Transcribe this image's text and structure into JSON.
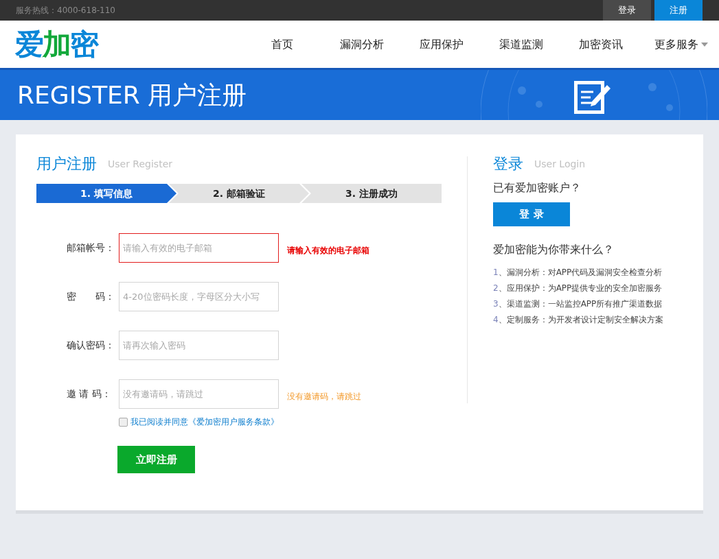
{
  "top_bar": {
    "hotline": "服务热线：4000-618-110",
    "buttons": [
      {
        "label": "登录",
        "selected": false
      },
      {
        "label": "注册",
        "selected": true
      }
    ]
  },
  "header": {
    "logo": [
      {
        "text": "爱",
        "color": "#0a86d8"
      },
      {
        "text": "加",
        "color": "#12a83a"
      },
      {
        "text": "密",
        "color": "#0a86d8"
      }
    ],
    "nav": [
      {
        "label": "首页",
        "selected": false,
        "has_menu": false
      },
      {
        "label": "漏洞分析",
        "selected": false,
        "has_menu": false
      },
      {
        "label": "应用保护",
        "selected": false,
        "has_menu": false
      },
      {
        "label": "渠道监测",
        "selected": false,
        "has_menu": false
      },
      {
        "label": "加密资讯",
        "selected": false,
        "has_menu": false
      },
      {
        "label": "更多服务",
        "selected": false,
        "has_menu": true
      }
    ]
  },
  "banner": {
    "title": "REGISTER 用户注册"
  },
  "register": {
    "title": "用户注册",
    "subtitle": "User Register",
    "steps": [
      {
        "label": "1. 填写信息",
        "selected": true
      },
      {
        "label": "2. 邮箱验证",
        "selected": false
      },
      {
        "label": "3. 注册成功",
        "selected": false
      }
    ],
    "fields": [
      {
        "label": "邮箱帐号：",
        "placeholder": "请输入有效的电子邮箱",
        "error": true,
        "message": {
          "text": "请输入有效的电子邮箱",
          "kind": "error"
        }
      },
      {
        "label": "密　　码：",
        "placeholder": "4-20位密码长度，字母区分大小写",
        "error": false
      },
      {
        "label": "确认密码：",
        "placeholder": "请再次输入密码",
        "error": false
      },
      {
        "label": "邀 请 码：",
        "placeholder": "没有邀请码，请跳过",
        "error": false,
        "message": {
          "text": "没有邀请码，请跳过",
          "kind": "hint"
        }
      }
    ],
    "agreement": {
      "label": "我已阅读并同意《爱加密用户服务条款》",
      "checked": false
    },
    "submit": "立即注册"
  },
  "login": {
    "title": "登录",
    "subtitle": "User Login",
    "question": "已有爱加密账户？",
    "button": "登 录",
    "benefits_title": "爱加密能为你带来什么？",
    "benefits": [
      {
        "number": "1",
        "text": "、漏洞分析：对APP代码及漏洞安全检查分析"
      },
      {
        "number": "2",
        "text": "、应用保护：为APP提供专业的安全加密服务"
      },
      {
        "number": "3",
        "text": "、渠道监测：一站监控APP所有推广渠道数据"
      },
      {
        "number": "4",
        "text": "、定制服务：为开发者设计定制安全解决方案"
      }
    ]
  }
}
